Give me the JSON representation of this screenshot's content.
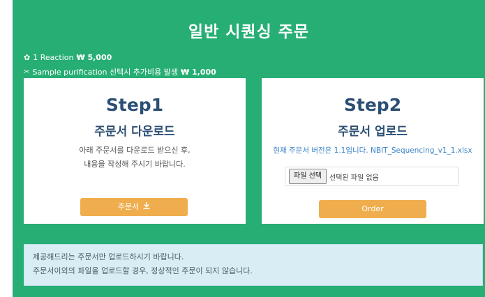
{
  "page": {
    "title": "일반 시퀀싱 주문"
  },
  "pricing": {
    "line1_icon": "gear-icon",
    "line1_text": "1 Reaction",
    "line1_price": "₩ 5,000",
    "line2_icon": "scissors-icon",
    "line2_text": "Sample purification 선택시 추가비용 발생",
    "line2_price": "₩ 1,000"
  },
  "step1": {
    "step_label": "Step1",
    "title": "주문서 다운로드",
    "desc_line1": "아래 주문서를 다운로드 받으신 후,",
    "desc_line2": "내용을 작성해 주시기 바랍니다.",
    "button_label": "주문서",
    "button_icon": "download-icon"
  },
  "step2": {
    "step_label": "Step2",
    "title": "주문서 업로드",
    "desc": "현재 주문서 버전은 1.1입니다. NBIT_Sequencing_v1_1.xlsx",
    "file_button_label": "파일 선택",
    "file_status": "선택된 파일 없음",
    "order_button_label": "Order"
  },
  "notice": {
    "line1": "제공해드리는 주문서만 업로드하시기 바랍니다.",
    "line2": "주문서이외의 파일을 업로드할 경우, 정상적인 주문이 되지 않습니다."
  },
  "colors": {
    "panel_bg": "#27ae74",
    "step_title": "#2c4f73",
    "button": "#f0ad4e",
    "notice_bg": "#d8eef4"
  }
}
